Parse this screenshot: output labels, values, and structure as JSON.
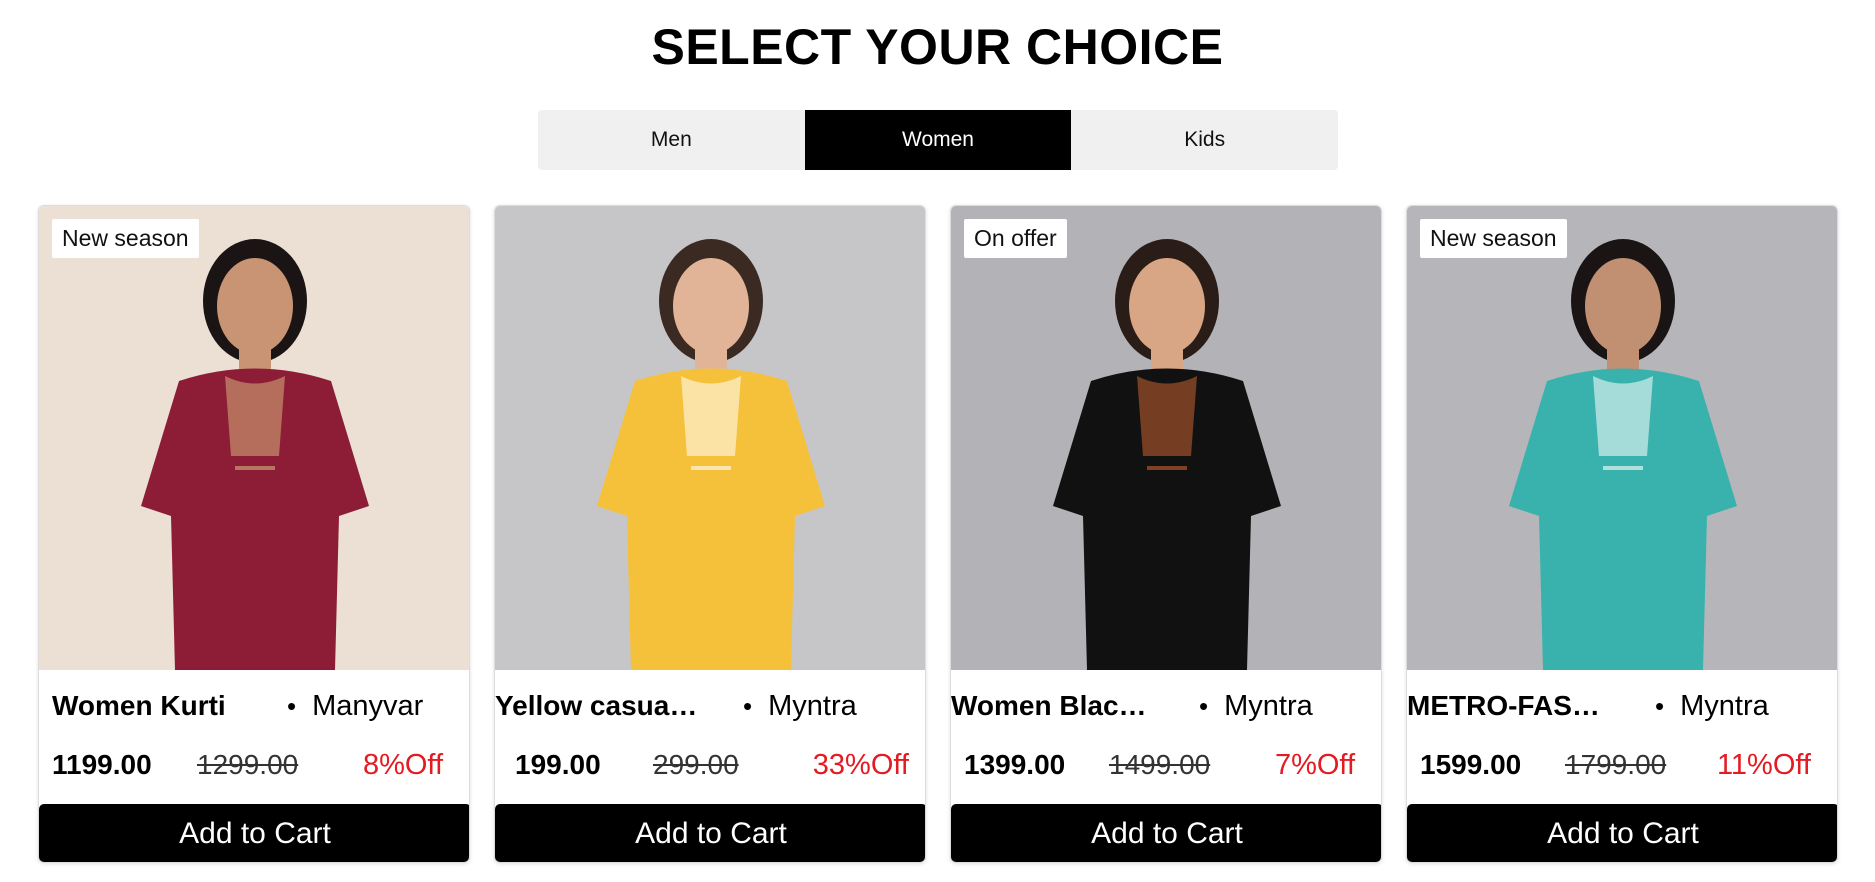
{
  "page": {
    "title": "SELECT YOUR CHOICE"
  },
  "tabs": [
    {
      "label": "Men",
      "active": false
    },
    {
      "label": "Women",
      "active": true
    },
    {
      "label": "Kids",
      "active": false
    }
  ],
  "products": [
    {
      "badge": "New season",
      "name": "Women Kurti",
      "brand": "Manyvar",
      "price": "1199.00",
      "mrp": "1299.00",
      "discount": "8%Off",
      "cta": "Add to Cart",
      "photo": {
        "bg": "#ebe0d3",
        "garment": "#8d1c36",
        "accent": "#d7b27a",
        "skin": "#c99474",
        "hair": "#1a1414"
      }
    },
    {
      "badge": "",
      "name": "Yellow casual kurti",
      "brand": "Myntra",
      "price": "199.00",
      "mrp": "299.00",
      "discount": "33%Off",
      "cta": "Add to Cart",
      "photo": {
        "bg": "#c6c5c8",
        "garment": "#f6c13a",
        "accent": "#ffffff",
        "skin": "#e1b497",
        "hair": "#3a2a22"
      }
    },
    {
      "badge": "On offer",
      "name": "Women Black kurti",
      "brand": "Myntra",
      "price": "1399.00",
      "mrp": "1499.00",
      "discount": "7%Off",
      "cta": "Add to Cart",
      "photo": {
        "bg": "#b3b3b7",
        "garment": "#111111",
        "accent": "#c9632f",
        "skin": "#d8a585",
        "hair": "#2a1c16"
      }
    },
    {
      "badge": "New season",
      "name": "METRO-FASHION kurta set",
      "brand": "Myntra",
      "price": "1599.00",
      "mrp": "1799.00",
      "discount": "11%Off",
      "cta": "Add to Cart",
      "photo": {
        "bg": "#b6b6ba",
        "garment": "#39b2ad",
        "accent": "#ffffff",
        "skin": "#c18f72",
        "hair": "#1a1414"
      }
    }
  ]
}
